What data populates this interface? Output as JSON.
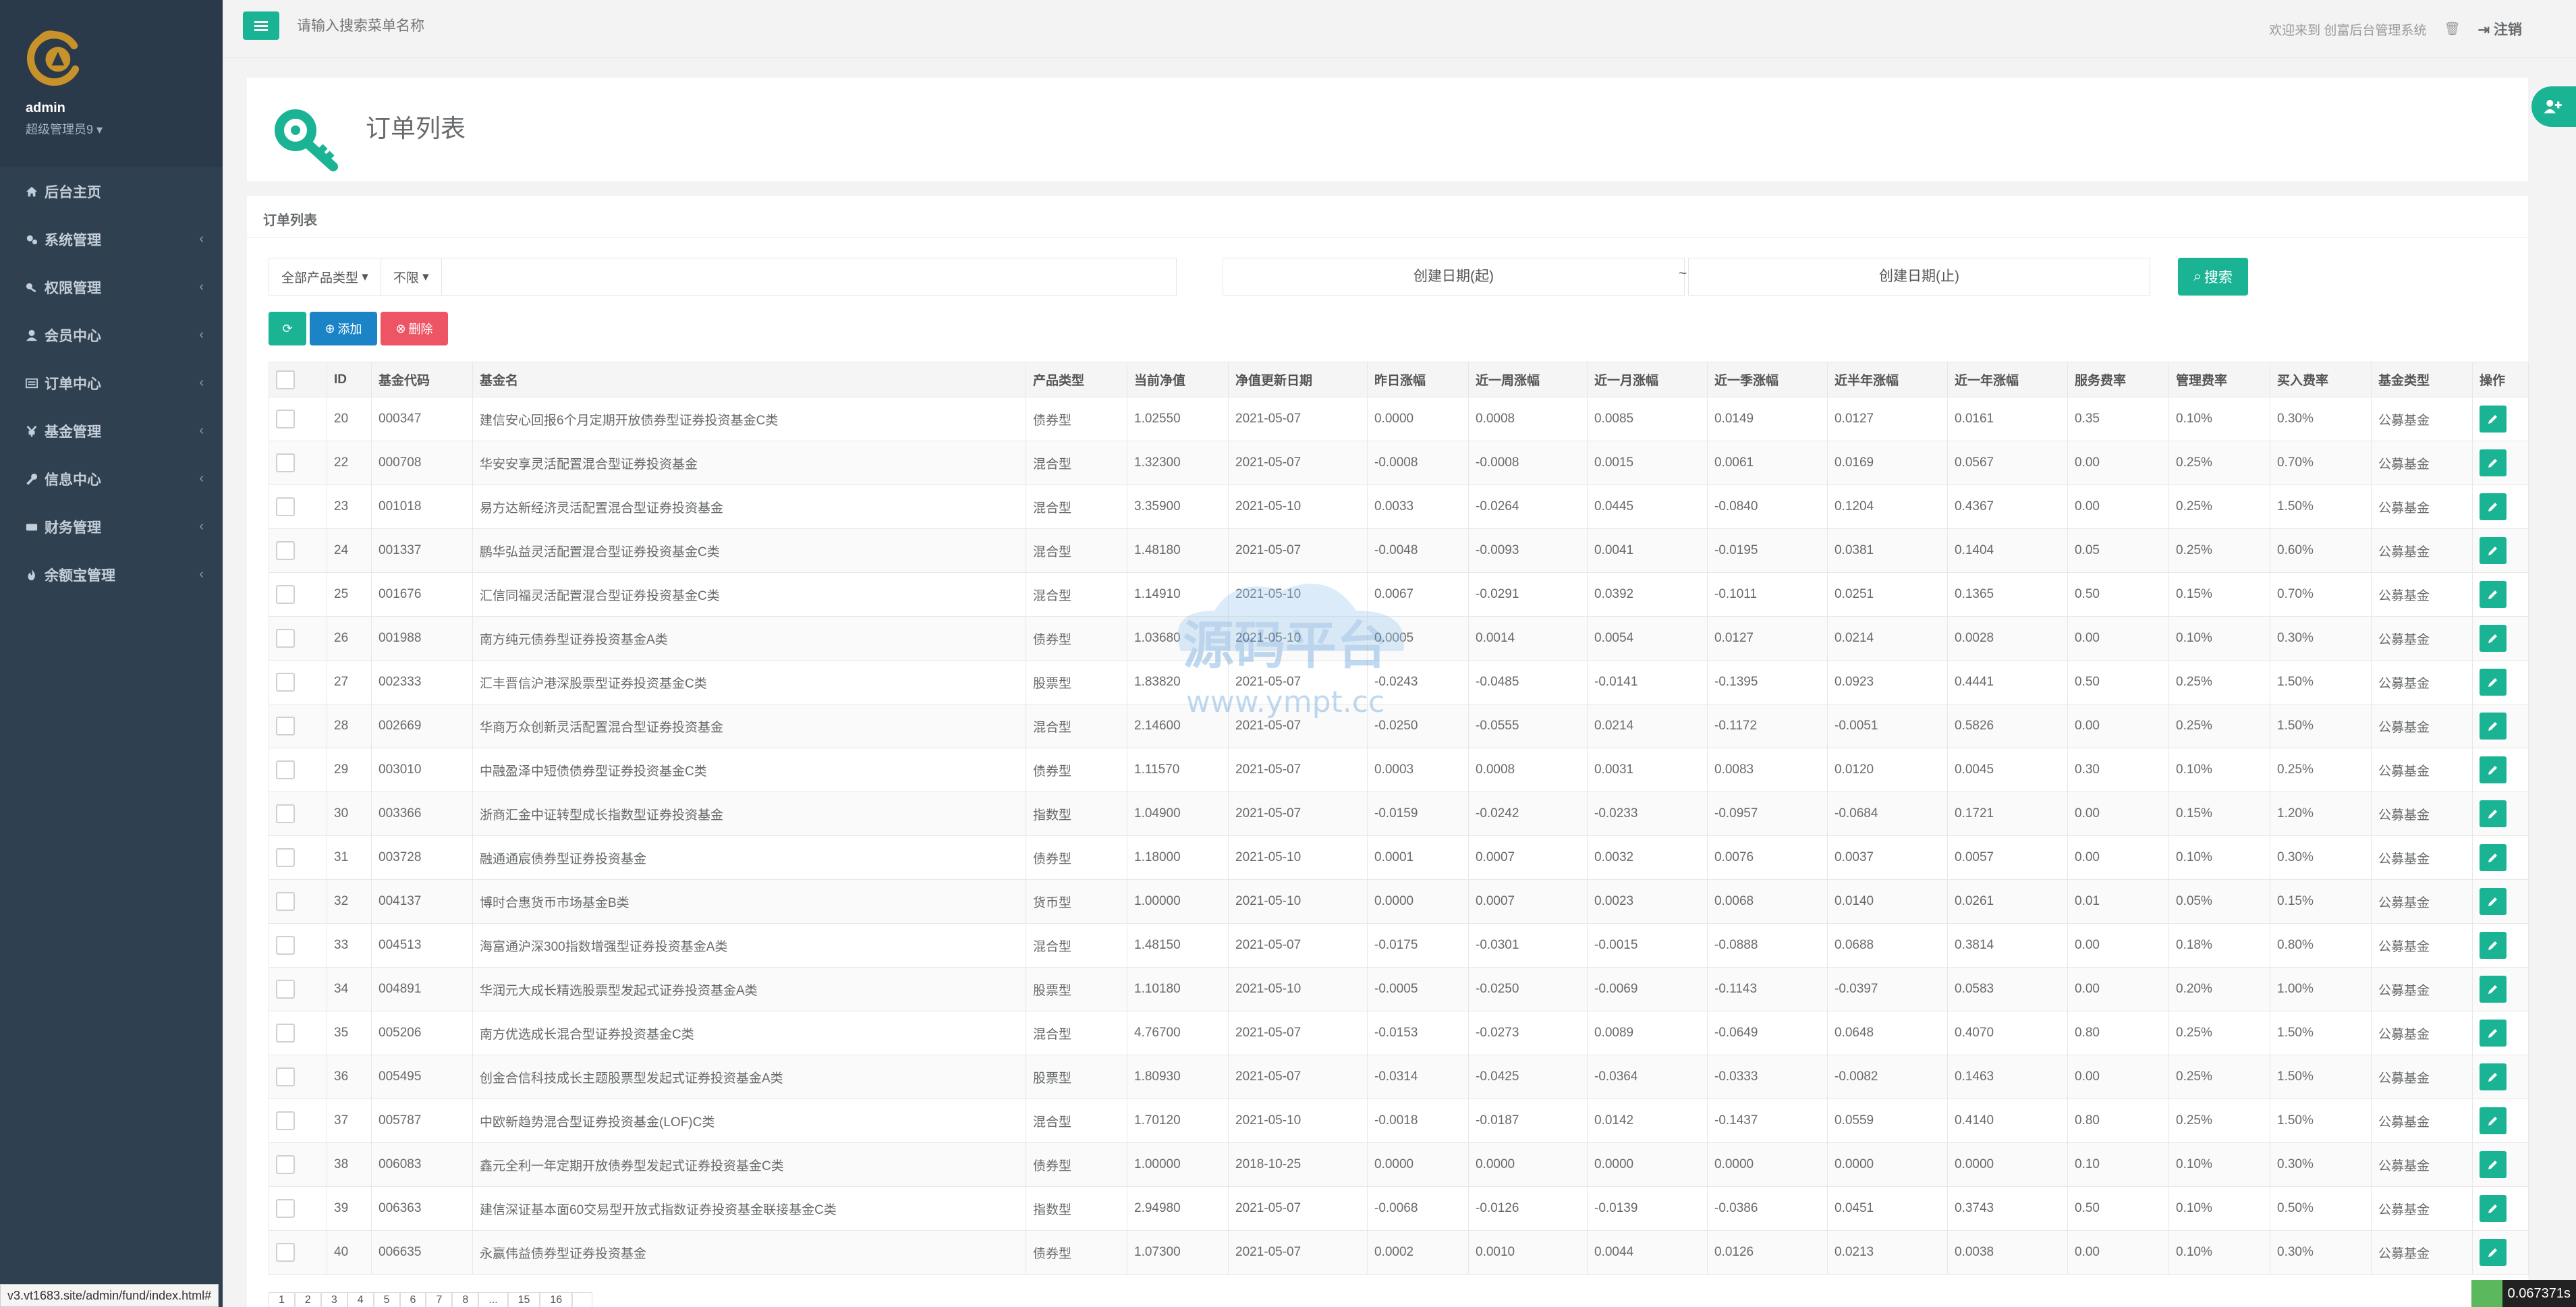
{
  "sidebar": {
    "user_name": "admin",
    "user_role": "超级管理员9",
    "items": [
      {
        "label": "后台主页",
        "icon": "home-icon"
      },
      {
        "label": "系统管理",
        "icon": "cogs-icon"
      },
      {
        "label": "权限管理",
        "icon": "key-icon"
      },
      {
        "label": "会员中心",
        "icon": "user-icon"
      },
      {
        "label": "订单中心",
        "icon": "list-icon"
      },
      {
        "label": "基金管理",
        "icon": "yen-icon"
      },
      {
        "label": "信息中心",
        "icon": "wrench-icon"
      },
      {
        "label": "财务管理",
        "icon": "money-icon"
      },
      {
        "label": "余额宝管理",
        "icon": "fire-icon"
      }
    ]
  },
  "topbar": {
    "search_placeholder": "请输入搜索菜单名称",
    "welcome": "欢迎来到 创富后台管理系统",
    "logout": "注销"
  },
  "page": {
    "title": "订单列表",
    "panel_title": "订单列表"
  },
  "filters": {
    "product_type": "全部产品类型",
    "limit": "不限",
    "date_start_placeholder": "创建日期(起)",
    "tilde": "~",
    "date_end_placeholder": "创建日期(止)",
    "search_label": "搜索"
  },
  "toolbar": {
    "add_label": "添加",
    "delete_label": "删除"
  },
  "table": {
    "headers": [
      "ID",
      "基金代码",
      "基金名",
      "产品类型",
      "当前净值",
      "净值更新日期",
      "昨日涨幅",
      "近一周涨幅",
      "近一月涨幅",
      "近一季涨幅",
      "近半年涨幅",
      "近一年涨幅",
      "服务费率",
      "管理费率",
      "买入费率",
      "基金类型",
      "操作"
    ],
    "rows": [
      [
        "20",
        "000347",
        "建信安心回报6个月定期开放债券型证券投资基金C类",
        "债券型",
        "1.02550",
        "2021-05-07",
        "0.0000",
        "0.0008",
        "0.0085",
        "0.0149",
        "0.0127",
        "0.0161",
        "0.35",
        "0.10%",
        "0.30%",
        "公募基金"
      ],
      [
        "22",
        "000708",
        "华安安享灵活配置混合型证券投资基金",
        "混合型",
        "1.32300",
        "2021-05-07",
        "-0.0008",
        "-0.0008",
        "0.0015",
        "0.0061",
        "0.0169",
        "0.0567",
        "0.00",
        "0.25%",
        "0.70%",
        "公募基金"
      ],
      [
        "23",
        "001018",
        "易方达新经济灵活配置混合型证券投资基金",
        "混合型",
        "3.35900",
        "2021-05-10",
        "0.0033",
        "-0.0264",
        "0.0445",
        "-0.0840",
        "0.1204",
        "0.4367",
        "0.00",
        "0.25%",
        "1.50%",
        "公募基金"
      ],
      [
        "24",
        "001337",
        "鹏华弘益灵活配置混合型证券投资基金C类",
        "混合型",
        "1.48180",
        "2021-05-07",
        "-0.0048",
        "-0.0093",
        "0.0041",
        "-0.0195",
        "0.0381",
        "0.1404",
        "0.05",
        "0.25%",
        "0.60%",
        "公募基金"
      ],
      [
        "25",
        "001676",
        "汇信同福灵活配置混合型证券投资基金C类",
        "混合型",
        "1.14910",
        "2021-05-10",
        "0.0067",
        "-0.0291",
        "0.0392",
        "-0.1011",
        "0.0251",
        "0.1365",
        "0.50",
        "0.15%",
        "0.70%",
        "公募基金"
      ],
      [
        "26",
        "001988",
        "南方纯元债券型证券投资基金A类",
        "债券型",
        "1.03680",
        "2021-05-10",
        "0.0005",
        "0.0014",
        "0.0054",
        "0.0127",
        "0.0214",
        "0.0028",
        "0.00",
        "0.10%",
        "0.30%",
        "公募基金"
      ],
      [
        "27",
        "002333",
        "汇丰晋信沪港深股票型证券投资基金C类",
        "股票型",
        "1.83820",
        "2021-05-07",
        "-0.0243",
        "-0.0485",
        "-0.0141",
        "-0.1395",
        "0.0923",
        "0.4441",
        "0.50",
        "0.25%",
        "1.50%",
        "公募基金"
      ],
      [
        "28",
        "002669",
        "华商万众创新灵活配置混合型证券投资基金",
        "混合型",
        "2.14600",
        "2021-05-07",
        "-0.0250",
        "-0.0555",
        "0.0214",
        "-0.1172",
        "-0.0051",
        "0.5826",
        "0.00",
        "0.25%",
        "1.50%",
        "公募基金"
      ],
      [
        "29",
        "003010",
        "中融盈泽中短债债券型证券投资基金C类",
        "债券型",
        "1.11570",
        "2021-05-07",
        "0.0003",
        "0.0008",
        "0.0031",
        "0.0083",
        "0.0120",
        "0.0045",
        "0.30",
        "0.10%",
        "0.25%",
        "公募基金"
      ],
      [
        "30",
        "003366",
        "浙商汇金中证转型成长指数型证券投资基金",
        "指数型",
        "1.04900",
        "2021-05-07",
        "-0.0159",
        "-0.0242",
        "-0.0233",
        "-0.0957",
        "-0.0684",
        "0.1721",
        "0.00",
        "0.15%",
        "1.20%",
        "公募基金"
      ],
      [
        "31",
        "003728",
        "融通通宸债券型证券投资基金",
        "债券型",
        "1.18000",
        "2021-05-10",
        "0.0001",
        "0.0007",
        "0.0032",
        "0.0076",
        "0.0037",
        "0.0057",
        "0.00",
        "0.10%",
        "0.30%",
        "公募基金"
      ],
      [
        "32",
        "004137",
        "博时合惠货币市场基金B类",
        "货币型",
        "1.00000",
        "2021-05-10",
        "0.0000",
        "0.0007",
        "0.0023",
        "0.0068",
        "0.0140",
        "0.0261",
        "0.01",
        "0.05%",
        "0.15%",
        "公募基金"
      ],
      [
        "33",
        "004513",
        "海富通沪深300指数增强型证券投资基金A类",
        "混合型",
        "1.48150",
        "2021-05-07",
        "-0.0175",
        "-0.0301",
        "-0.0015",
        "-0.0888",
        "0.0688",
        "0.3814",
        "0.00",
        "0.18%",
        "0.80%",
        "公募基金"
      ],
      [
        "34",
        "004891",
        "华润元大成长精选股票型发起式证券投资基金A类",
        "股票型",
        "1.10180",
        "2021-05-10",
        "-0.0005",
        "-0.0250",
        "-0.0069",
        "-0.1143",
        "-0.0397",
        "0.0583",
        "0.00",
        "0.20%",
        "1.00%",
        "公募基金"
      ],
      [
        "35",
        "005206",
        "南方优选成长混合型证券投资基金C类",
        "混合型",
        "4.76700",
        "2021-05-07",
        "-0.0153",
        "-0.0273",
        "0.0089",
        "-0.0649",
        "0.0648",
        "0.4070",
        "0.80",
        "0.25%",
        "1.50%",
        "公募基金"
      ],
      [
        "36",
        "005495",
        "创金合信科技成长主题股票型发起式证券投资基金A类",
        "股票型",
        "1.80930",
        "2021-05-07",
        "-0.0314",
        "-0.0425",
        "-0.0364",
        "-0.0333",
        "-0.0082",
        "0.1463",
        "0.00",
        "0.25%",
        "1.50%",
        "公募基金"
      ],
      [
        "37",
        "005787",
        "中欧新趋势混合型证券投资基金(LOF)C类",
        "混合型",
        "1.70120",
        "2021-05-10",
        "-0.0018",
        "-0.0187",
        "0.0142",
        "-0.1437",
        "0.0559",
        "0.4140",
        "0.80",
        "0.25%",
        "1.50%",
        "公募基金"
      ],
      [
        "38",
        "006083",
        "鑫元全利一年定期开放债券型发起式证券投资基金C类",
        "债券型",
        "1.00000",
        "2018-10-25",
        "0.0000",
        "0.0000",
        "0.0000",
        "0.0000",
        "0.0000",
        "0.0000",
        "0.10",
        "0.10%",
        "0.30%",
        "公募基金"
      ],
      [
        "39",
        "006363",
        "建信深证基本面60交易型开放式指数证券投资基金联接基金C类",
        "指数型",
        "2.94980",
        "2021-05-07",
        "-0.0068",
        "-0.0126",
        "-0.0139",
        "-0.0386",
        "0.0451",
        "0.3743",
        "0.50",
        "0.10%",
        "0.50%",
        "公募基金"
      ],
      [
        "40",
        "006635",
        "永赢伟益债券型证券投资基金",
        "债券型",
        "1.07300",
        "2021-05-07",
        "0.0002",
        "0.0010",
        "0.0044",
        "0.0126",
        "0.0213",
        "0.0038",
        "0.00",
        "0.10%",
        "0.30%",
        "公募基金"
      ]
    ]
  },
  "pagination": [
    "1",
    "2",
    "3",
    "4",
    "5",
    "6",
    "7",
    "8",
    "...",
    "15",
    "16",
    ""
  ],
  "watermark": {
    "brand": "源码平台",
    "url": "www.ympt.cc"
  },
  "status_url": "v3.vt1683.site/admin/fund/index.html#",
  "timer": "0.067371s",
  "colors": {
    "primary": "#1ab394",
    "info": "#1c84c6",
    "danger": "#ed5565",
    "sidebar": "#2f4050",
    "logo": "#c8922a"
  }
}
